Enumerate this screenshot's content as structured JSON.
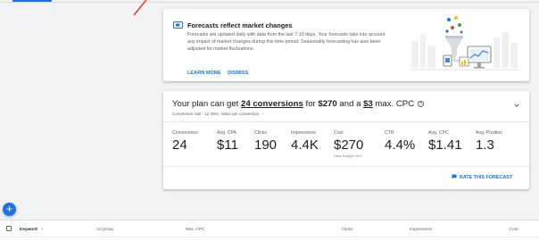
{
  "info_card": {
    "title": "Forecasts reflect market changes",
    "body": "Forecasts are updated daily with data from the last 7-10 days. Your forecasts take into account any impact of market changes during this time period. Seasonality forecasting has also been adjusted for market fluctuations.",
    "learn_more": "LEARN MORE",
    "dismiss": "DISMISS",
    "icon": "flag-icon",
    "accent": "#1a73e8"
  },
  "plan": {
    "prefix": "Your plan can get ",
    "conversions": "24 conversions",
    "for": " for ",
    "budget": "$270",
    "and": " and a ",
    "max_cpc": "$3",
    "suffix": " max. CPC",
    "help_icon": "help-icon",
    "sub": "Conversion rate : 12.49%, Value per conversion : -",
    "chevron_icon": "chevron-down-icon",
    "metrics": [
      {
        "label": "Conversions",
        "value": "24",
        "note": ""
      },
      {
        "label": "Avg. CPA",
        "value": "$11",
        "note": ""
      },
      {
        "label": "Clicks",
        "value": "190",
        "note": ""
      },
      {
        "label": "Impressions",
        "value": "4.4K",
        "note": ""
      },
      {
        "label": "Cost",
        "value": "$270",
        "note": "Daily Budget: $15"
      },
      {
        "label": "CTR",
        "value": "4.4%",
        "note": ""
      },
      {
        "label": "Avg. CPC",
        "value": "$1.41",
        "note": ""
      },
      {
        "label": "Avg. Position",
        "value": "1.3",
        "note": ""
      }
    ],
    "rate_button": "RATE THIS FORECAST"
  },
  "fab": {
    "label": "+"
  },
  "table": {
    "columns": [
      "Keyword",
      "Ad group",
      "Max. CPC",
      "Clicks",
      "Impressions",
      "Cost"
    ],
    "sort_indicator": "↑"
  }
}
